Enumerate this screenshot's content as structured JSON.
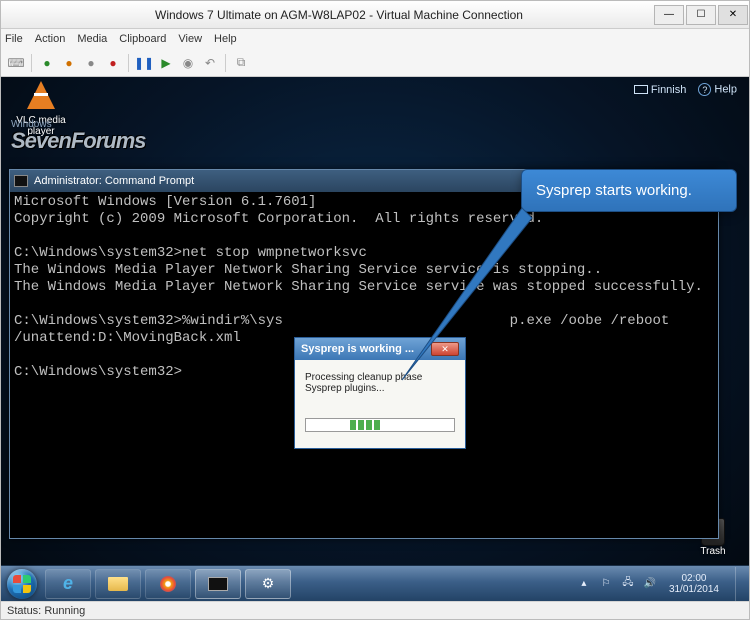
{
  "vm": {
    "title": "Windows 7 Ultimate on AGM-W8LAP02 - Virtual Machine Connection",
    "menu": {
      "file": "File",
      "action": "Action",
      "media": "Media",
      "clipboard": "Clipboard",
      "view": "View",
      "help": "Help"
    },
    "status_label": "Status:",
    "status_value": "Running"
  },
  "desktop": {
    "lang": "Finnish",
    "help": "Help",
    "vlc_label": "VLC media player",
    "trash_label": "Trash",
    "sevenforums_small": "Windows",
    "sevenforums_big": "SevenForums"
  },
  "cmd": {
    "title": "Administrator: Command Prompt",
    "lines": "Microsoft Windows [Version 6.1.7601]\nCopyright (c) 2009 Microsoft Corporation.  All rights reserved.\n\nC:\\Windows\\system32>net stop wmpnetworksvc\nThe Windows Media Player Network Sharing Service service is stopping..\nThe Windows Media Player Network Sharing Service service was stopped successfully.\n\nC:\\Windows\\system32>%windir%\\sys                           p.exe /oobe /reboot /unattend:D:\\MovingBack.xml\n\nC:\\Windows\\system32>"
  },
  "sysprep": {
    "title": "Sysprep is working ...",
    "message": "Processing cleanup phase Sysprep plugins..."
  },
  "callout": {
    "text": "Sysprep starts working."
  },
  "tray": {
    "time": "02:00",
    "date": "31/01/2014"
  }
}
